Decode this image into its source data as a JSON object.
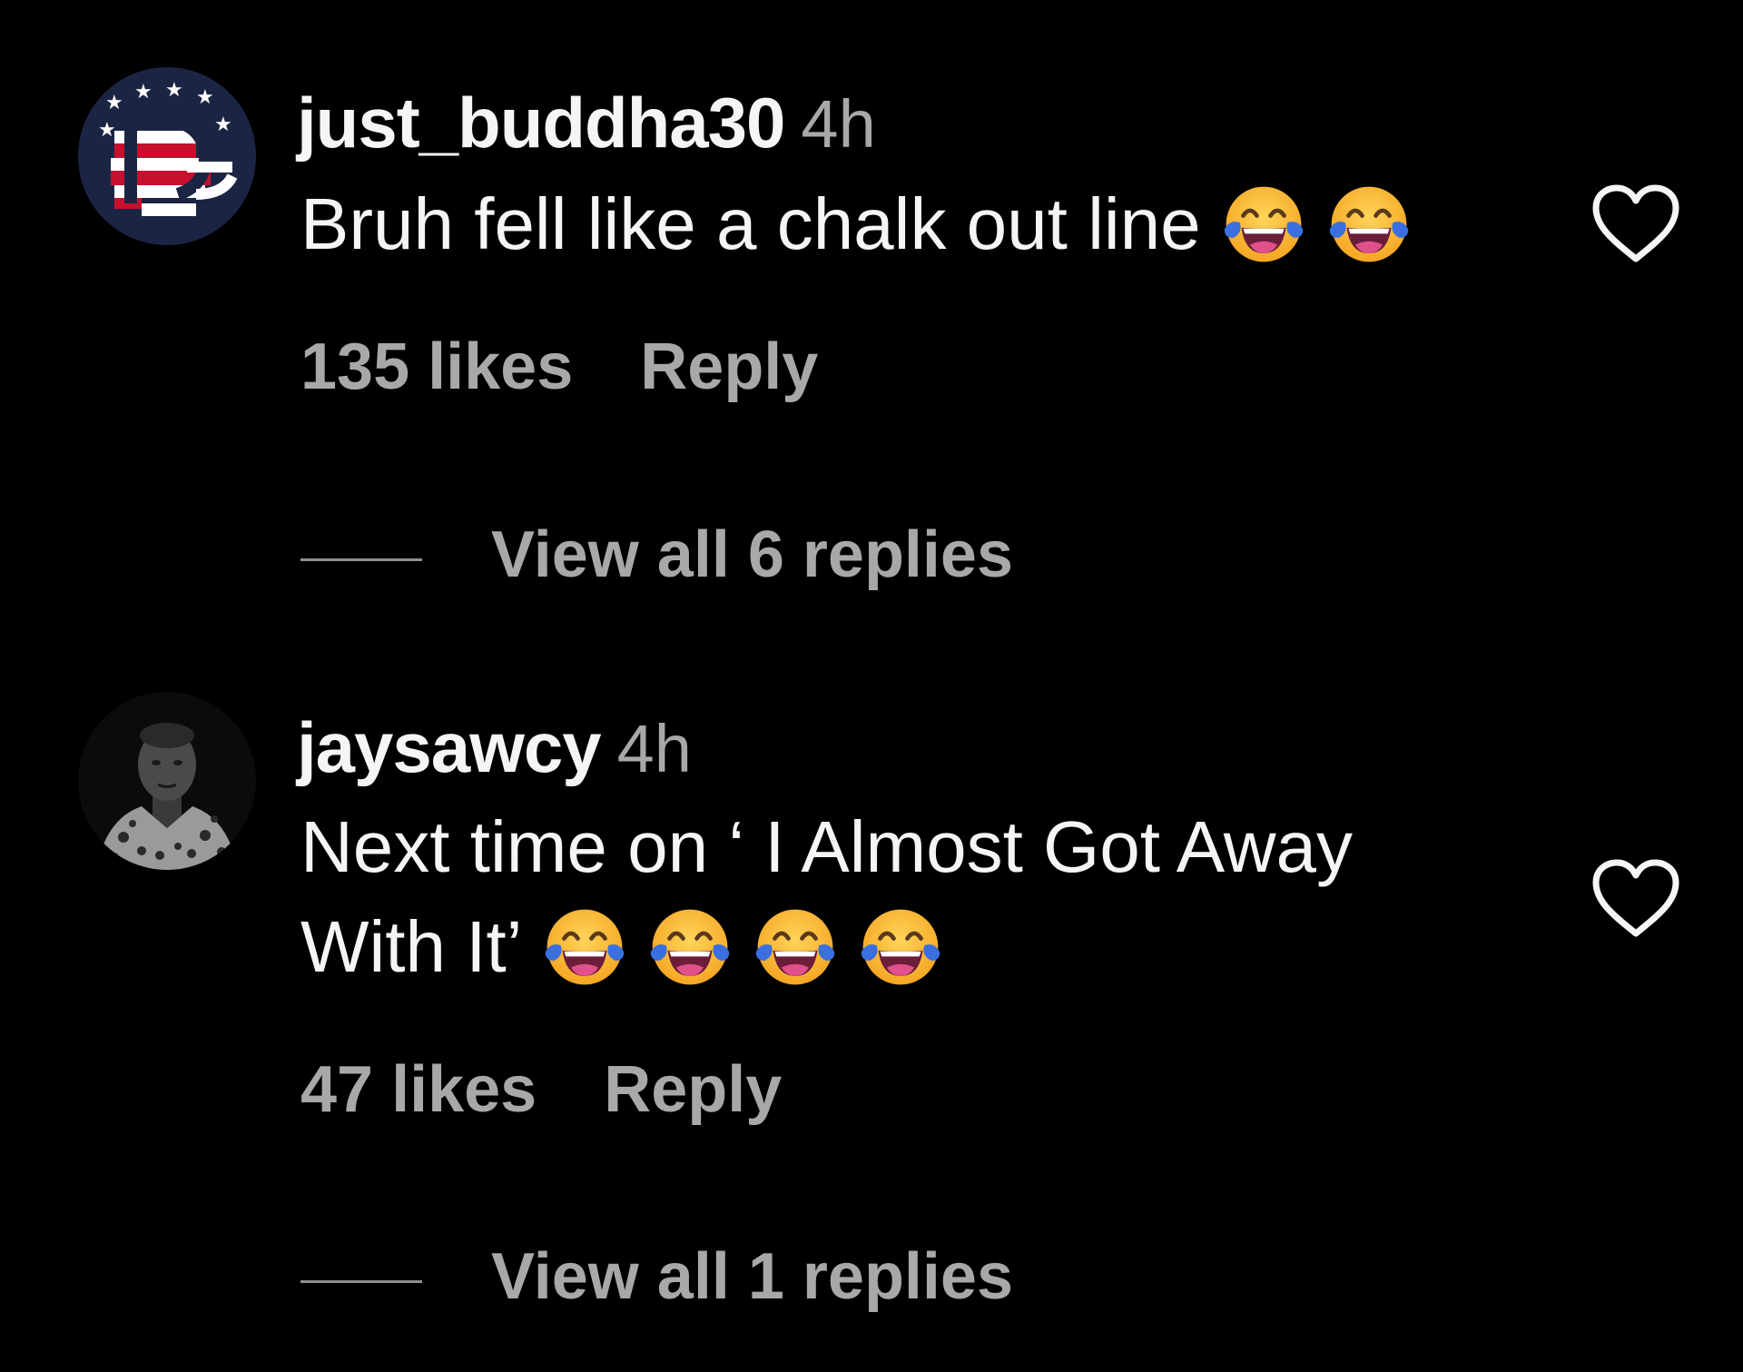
{
  "comments": [
    {
      "username": "just_buddha30",
      "time": "4h",
      "text": "Bruh fell like a chalk out line",
      "emojis": [
        "face-with-tears-of-joy-icon",
        "face-with-tears-of-joy-icon"
      ],
      "likes": "135 likes",
      "reply_label": "Reply",
      "view_replies_label": "View all 6 replies",
      "avatar": "flag-logo-avatar"
    },
    {
      "username": "jaysawcy",
      "time": "4h",
      "text": "Next time on ‘ I Almost Got Away With It’",
      "emojis": [
        "face-with-tears-of-joy-icon",
        "face-with-tears-of-joy-icon",
        "face-with-tears-of-joy-icon",
        "face-with-tears-of-joy-icon"
      ],
      "likes": "47 likes",
      "reply_label": "Reply",
      "view_replies_label": "View all 1 replies",
      "avatar": "profile-photo-avatar"
    }
  ],
  "colors": {
    "background": "#000000",
    "primary_text": "#f5f5f5",
    "secondary_text": "#a8a8a8",
    "emoji_face": "#f7b733",
    "emoji_tears": "#5b9cf3"
  },
  "icons": {
    "like": "heart-outline-icon"
  }
}
